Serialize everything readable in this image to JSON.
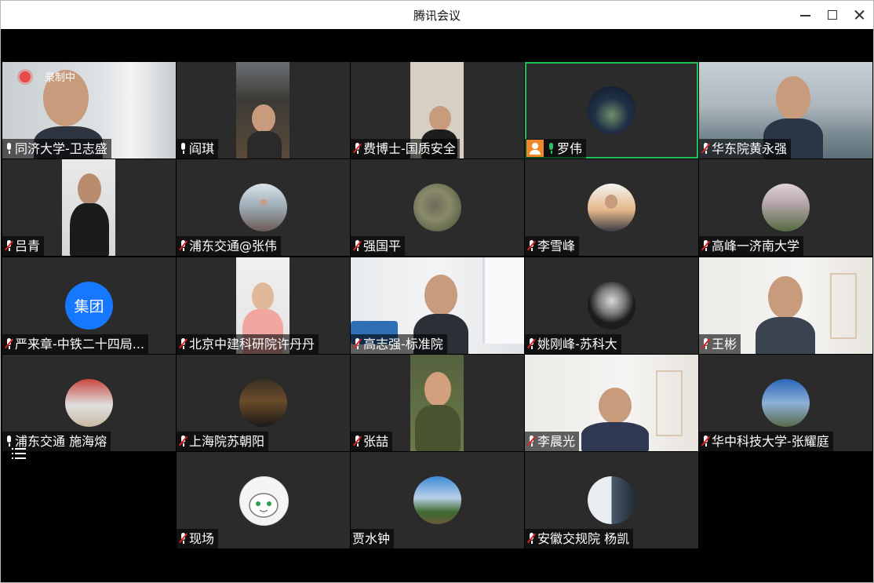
{
  "window": {
    "title": "腾讯会议"
  },
  "recording": {
    "label": "录制中"
  },
  "tiles": [
    {
      "name": "同济大学-卫志盛",
      "mic": "on-white"
    },
    {
      "name": "阎琪",
      "mic": "on-white"
    },
    {
      "name": "费博士-国质安全",
      "mic": "muted"
    },
    {
      "name": "罗伟",
      "mic": "speaking",
      "host": true,
      "active": true
    },
    {
      "name": "华东院黄永强",
      "mic": "muted"
    },
    {
      "name": "吕青",
      "mic": "muted"
    },
    {
      "name": "浦东交通@张伟",
      "mic": "muted"
    },
    {
      "name": "强国平",
      "mic": "muted"
    },
    {
      "name": "李雪峰",
      "mic": "muted"
    },
    {
      "name": "高峰一济南大学",
      "mic": "muted"
    },
    {
      "name": "严来章-中铁二十四局...",
      "mic": "muted",
      "avatar_text": "集团"
    },
    {
      "name": "北京中建科研院许丹丹",
      "mic": "muted"
    },
    {
      "name": "高志强-标准院",
      "mic": "muted"
    },
    {
      "name": "姚刚峰-苏科大",
      "mic": "muted"
    },
    {
      "name": "王彬",
      "mic": "muted"
    },
    {
      "name": "浦东交通 施海熔",
      "mic": "on-white"
    },
    {
      "name": "上海院苏朝阳",
      "mic": "muted"
    },
    {
      "name": "张喆",
      "mic": "muted"
    },
    {
      "name": "李晨光",
      "mic": "muted"
    },
    {
      "name": "华中科技大学-张耀庭",
      "mic": "muted"
    },
    {
      "name": "现场",
      "mic": "muted"
    },
    {
      "name": "贾水钟",
      "mic": "none"
    },
    {
      "name": "安徽交规院 杨凯",
      "mic": "muted"
    }
  ],
  "icons": {
    "minimize": "minimize-icon",
    "maximize": "maximize-icon",
    "close": "close-icon",
    "mic_on": "microphone-icon",
    "mic_muted": "microphone-muted-icon",
    "host": "host-badge-icon",
    "grid_menu": "participant-list-icon"
  },
  "colors": {
    "active_border": "#1fc15a",
    "muted_slash": "#e02020",
    "speaking_mic": "#27c266",
    "host_badge": "#f0862a",
    "avatar_blue": "#1677ff"
  }
}
